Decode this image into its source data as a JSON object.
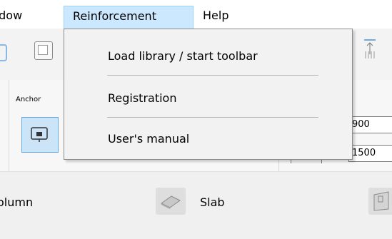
{
  "menubar": {
    "window_label": "ndow",
    "reinforcement_label": "Reinforcement",
    "help_label": "Help"
  },
  "dropdown": {
    "items": [
      {
        "label": "Load library / start toolbar"
      },
      {
        "label": "Registration"
      },
      {
        "label": "User's manual"
      }
    ]
  },
  "panel": {
    "anchor_label": "Anchor",
    "field_1_value": "900",
    "field_2_value": "1500"
  },
  "ribbon": {
    "column_label": "olumn",
    "slab_label": "Slab"
  },
  "colors": {
    "menu_highlight": "#cce8ff",
    "selected_button": "#cce4f7",
    "menu_background": "#f2f2f2"
  },
  "icons": [
    "toolbar-frame-icon",
    "select-box-icon",
    "arrow-up-icon",
    "anchor-icon",
    "slab-icon",
    "wall-icon"
  ]
}
